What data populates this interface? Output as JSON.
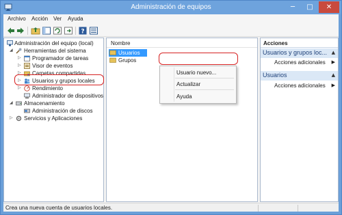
{
  "window": {
    "title": "Administración de equipos",
    "minimize": "─",
    "maximize": "□",
    "close": "✕"
  },
  "menu": [
    "Archivo",
    "Acción",
    "Ver",
    "Ayuda"
  ],
  "toolbar": [
    "back-icon",
    "forward-icon",
    "up-folder-icon",
    "show-hide-tree-icon",
    "refresh-icon",
    "export-icon",
    "help-icon",
    "properties-icon"
  ],
  "tree": [
    {
      "label": "Administración del equipo (local)",
      "expander": "",
      "icon": "computer-management-icon"
    },
    {
      "label": "Herramientas del sistema",
      "expander": "◢",
      "icon": "tools-icon"
    },
    {
      "label": "Programador de tareas",
      "expander": "▷",
      "icon": "task-scheduler-icon"
    },
    {
      "label": "Visor de eventos",
      "expander": "▷",
      "icon": "event-viewer-icon"
    },
    {
      "label": "Carpetas compartidas",
      "expander": "▷",
      "icon": "shared-folder-icon"
    },
    {
      "label": "Usuarios y grupos locales",
      "expander": "▷",
      "icon": "users-groups-icon"
    },
    {
      "label": "Rendimiento",
      "expander": "▷",
      "icon": "performance-icon"
    },
    {
      "label": "Administrador de dispositivos",
      "expander": "",
      "icon": "device-manager-icon"
    },
    {
      "label": "Almacenamiento",
      "expander": "◢",
      "icon": "storage-icon"
    },
    {
      "label": "Administración de discos",
      "expander": "",
      "icon": "disk-management-icon"
    },
    {
      "label": "Servicios y Aplicaciones",
      "expander": "▷",
      "icon": "services-icon"
    }
  ],
  "list": {
    "column_header": "Nombre",
    "items": [
      {
        "label": "Usuarios",
        "icon": "folder-icon",
        "selected": true
      },
      {
        "label": "Grupos",
        "icon": "folder-icon",
        "selected": false
      }
    ]
  },
  "context_menu": [
    "Usuario nuevo...",
    "Actualizar",
    "Ayuda"
  ],
  "actions": {
    "title": "Acciones",
    "groups": [
      {
        "title": "Usuarios y grupos loc...",
        "item": "Acciones adicionales",
        "collapse": "▲",
        "arrow": "▶"
      },
      {
        "title": "Usuarios",
        "item": "Acciones adicionales",
        "collapse": "▲",
        "arrow": "▶"
      }
    ]
  },
  "status": "Crea una nueva cuenta de usuarios locales.",
  "colors": {
    "titlebar": "#6ea3dd",
    "selection": "#3399ff",
    "highlight": "#d62020",
    "action_group": "#dbe8f6"
  }
}
